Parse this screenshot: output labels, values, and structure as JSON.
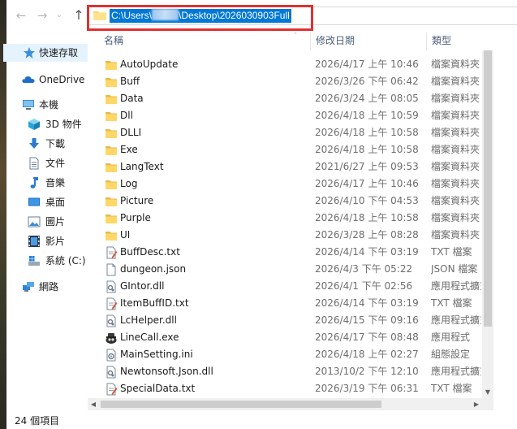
{
  "nav": {
    "back_icon": "arrow-left-icon",
    "forward_icon": "arrow-right-icon",
    "recent_icon": "chevron-down-icon",
    "up_icon": "arrow-up-icon"
  },
  "address": {
    "path_prefix": "C:\\Users\\",
    "path_suffix": "\\Desktop\\2026030903Full"
  },
  "sidebar": {
    "items": [
      {
        "label": "快速存取",
        "icon": "star-icon",
        "selected": true
      },
      {
        "label": "OneDrive",
        "icon": "cloud-icon"
      },
      {
        "label": "本機",
        "icon": "computer-icon"
      },
      {
        "label": "3D 物件",
        "icon": "cube-icon"
      },
      {
        "label": "下載",
        "icon": "download-icon"
      },
      {
        "label": "文件",
        "icon": "document-icon"
      },
      {
        "label": "音樂",
        "icon": "music-icon"
      },
      {
        "label": "桌面",
        "icon": "desktop-icon"
      },
      {
        "label": "圖片",
        "icon": "pictures-icon"
      },
      {
        "label": "影片",
        "icon": "videos-icon"
      },
      {
        "label": "系統 (C:)",
        "icon": "drive-icon"
      },
      {
        "label": "網路",
        "icon": "network-icon"
      }
    ]
  },
  "columns": {
    "name": "名稱",
    "date": "修改日期",
    "type": "類型"
  },
  "files": [
    {
      "name": "AutoUpdate",
      "date": "2026/4/17 上午 10:46",
      "type": "檔案資料夾",
      "icon": "folder-icon"
    },
    {
      "name": "Buff",
      "date": "2026/3/26 下午 06:42",
      "type": "檔案資料夾",
      "icon": "folder-icon"
    },
    {
      "name": "Data",
      "date": "2026/3/24 上午 08:05",
      "type": "檔案資料夾",
      "icon": "folder-icon"
    },
    {
      "name": "Dll",
      "date": "2026/4/18 上午 10:59",
      "type": "檔案資料夾",
      "icon": "folder-icon"
    },
    {
      "name": "DLLI",
      "date": "2026/4/18 上午 10:58",
      "type": "檔案資料夾",
      "icon": "folder-icon"
    },
    {
      "name": "Exe",
      "date": "2026/4/18 上午 10:58",
      "type": "檔案資料夾",
      "icon": "folder-icon"
    },
    {
      "name": "LangText",
      "date": "2021/6/27 上午 09:53",
      "type": "檔案資料夾",
      "icon": "folder-icon"
    },
    {
      "name": "Log",
      "date": "2026/4/17 上午 10:46",
      "type": "檔案資料夾",
      "icon": "folder-icon"
    },
    {
      "name": "Picture",
      "date": "2026/4/10 下午 04:53",
      "type": "檔案資料夾",
      "icon": "folder-icon"
    },
    {
      "name": "Purple",
      "date": "2026/4/18 上午 10:58",
      "type": "檔案資料夾",
      "icon": "folder-icon"
    },
    {
      "name": "UI",
      "date": "2026/3/28 上午 08:28",
      "type": "檔案資料夾",
      "icon": "folder-icon"
    },
    {
      "name": "BuffDesc.txt",
      "date": "2026/4/14 下午 03:19",
      "type": "TXT 檔案",
      "icon": "text-file-icon"
    },
    {
      "name": "dungeon.json",
      "date": "2026/4/3 下午 05:22",
      "type": "JSON 檔案",
      "icon": "json-file-icon"
    },
    {
      "name": "GIntor.dll",
      "date": "2026/4/1 下午 02:56",
      "type": "應用程式擴充",
      "icon": "dll-file-icon"
    },
    {
      "name": "ItemBuffID.txt",
      "date": "2026/4/14 下午 03:19",
      "type": "TXT 檔案",
      "icon": "text-file-icon"
    },
    {
      "name": "LcHelper.dll",
      "date": "2026/4/15 下午 09:16",
      "type": "應用程式擴充",
      "icon": "dll-file-icon"
    },
    {
      "name": "LineCall.exe",
      "date": "2026/4/17 下午 08:48",
      "type": "應用程式",
      "icon": "app-exe-icon"
    },
    {
      "name": "MainSetting.ini",
      "date": "2026/4/18 上午 02:27",
      "type": "組態設定",
      "icon": "ini-file-icon"
    },
    {
      "name": "Newtonsoft.Json.dll",
      "date": "2013/10/2 下午 12:10",
      "type": "應用程式擴充",
      "icon": "dll-file-icon"
    },
    {
      "name": "SpecialData.txt",
      "date": "2026/3/19 下午 06:31",
      "type": "TXT 檔案",
      "icon": "text-file-icon"
    }
  ],
  "status": {
    "item_count": "24 個項目"
  }
}
